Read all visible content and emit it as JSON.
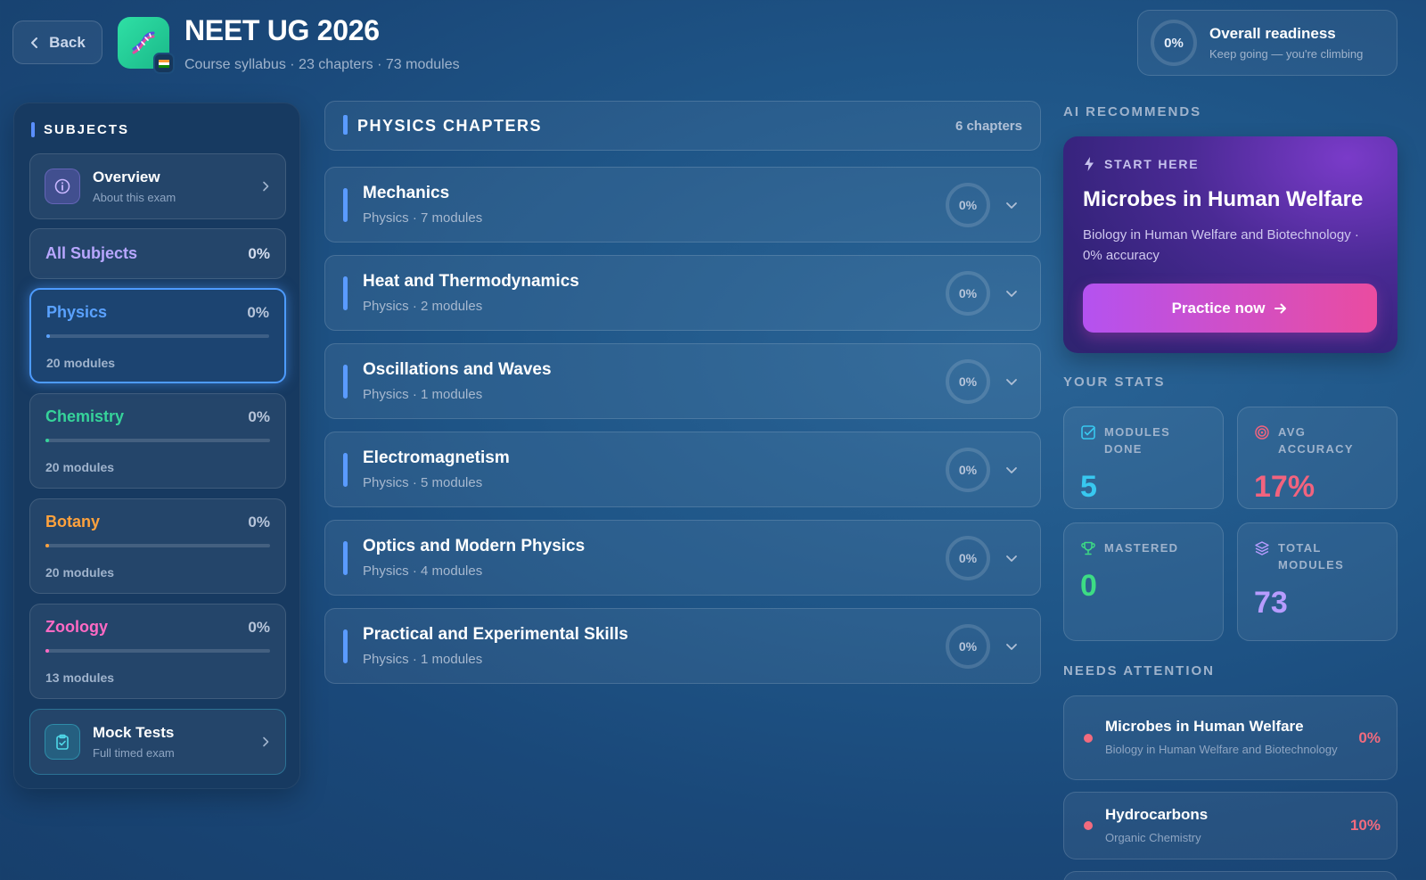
{
  "header": {
    "back_label": "Back",
    "title": "NEET UG 2026",
    "subtitle": "Course syllabus · 23 chapters · 73 modules",
    "readiness": {
      "value": "0%",
      "title": "Overall readiness",
      "subtitle": "Keep going — you're climbing"
    }
  },
  "sidebar": {
    "title": "SUBJECTS",
    "overview": {
      "title": "Overview",
      "subtitle": "About this exam"
    },
    "all_subjects": {
      "label": "All Subjects",
      "pct": "0%"
    },
    "subjects": [
      {
        "name": "Physics",
        "pct": "0%",
        "progress": 0,
        "modules": "20 modules",
        "color": "#5aa2ff",
        "active": true
      },
      {
        "name": "Chemistry",
        "pct": "0%",
        "progress": 0,
        "modules": "20 modules",
        "color": "#36d39a",
        "active": false
      },
      {
        "name": "Botany",
        "pct": "0%",
        "progress": 0,
        "modules": "20 modules",
        "color": "#ffa23d",
        "active": false
      },
      {
        "name": "Zoology",
        "pct": "0%",
        "progress": 0,
        "modules": "13 modules",
        "color": "#ff6ac4",
        "active": false
      }
    ],
    "mock_tests": {
      "title": "Mock Tests",
      "subtitle": "Full timed exam"
    }
  },
  "main": {
    "section_title": "PHYSICS CHAPTERS",
    "count": "6 chapters",
    "chapters": [
      {
        "title": "Mechanics",
        "subtitle": "Physics · 7 modules",
        "pct": "0%"
      },
      {
        "title": "Heat and Thermodynamics",
        "subtitle": "Physics · 2 modules",
        "pct": "0%"
      },
      {
        "title": "Oscillations and Waves",
        "subtitle": "Physics · 1 modules",
        "pct": "0%"
      },
      {
        "title": "Electromagnetism",
        "subtitle": "Physics · 5 modules",
        "pct": "0%"
      },
      {
        "title": "Optics and Modern Physics",
        "subtitle": "Physics · 4 modules",
        "pct": "0%"
      },
      {
        "title": "Practical and Experimental Skills",
        "subtitle": "Physics · 1 modules",
        "pct": "0%"
      }
    ]
  },
  "right": {
    "ai_title": "AI RECOMMENDS",
    "ai_card": {
      "tag": "START HERE",
      "title": "Microbes in Human Welfare",
      "description": "Biology in Human Welfare and Biotechnology · 0% accuracy",
      "button": "Practice now"
    },
    "stats_title": "YOUR STATS",
    "stats": [
      {
        "label": "MODULES DONE",
        "value": "5",
        "color": "#38c8f0",
        "icon": "checkbox-icon"
      },
      {
        "label": "AVG ACCURACY",
        "value": "17%",
        "color": "#f2637e",
        "icon": "target-icon"
      },
      {
        "label": "MASTERED",
        "value": "0",
        "color": "#3ddc84",
        "icon": "trophy-icon"
      },
      {
        "label": "TOTAL MODULES",
        "value": "73",
        "color": "#b79cff",
        "icon": "layers-icon"
      }
    ],
    "attention_title": "NEEDS ATTENTION",
    "attention": [
      {
        "title": "Microbes in Human Welfare",
        "subtitle": "Biology in Human Welfare and Biotechnology",
        "pct": "0%"
      },
      {
        "title": "Hydrocarbons",
        "subtitle": "Organic Chemistry",
        "pct": "10%"
      }
    ]
  }
}
